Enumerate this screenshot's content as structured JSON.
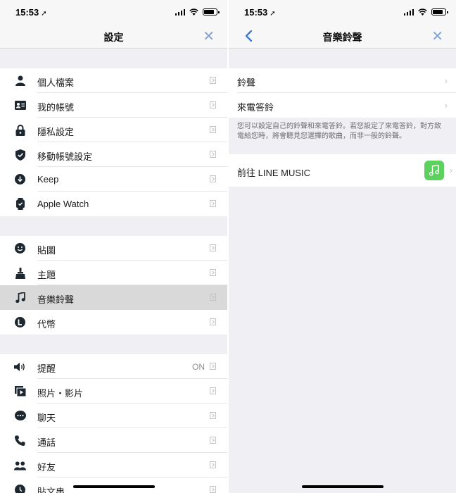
{
  "status_left": {
    "time": "15:53",
    "loc": "➚"
  },
  "status_right": {
    "time": "15:53",
    "loc": "➚"
  },
  "left": {
    "title": "設定",
    "close": "✕",
    "sections": [
      {
        "items": [
          {
            "label": "個人檔案",
            "icon": "person-icon"
          },
          {
            "label": "我的帳號",
            "icon": "id-card-icon"
          },
          {
            "label": "隱私設定",
            "icon": "lock-icon"
          },
          {
            "label": "移動帳號設定",
            "icon": "shield-check-icon"
          },
          {
            "label": "Keep",
            "icon": "keep-icon"
          },
          {
            "label": "Apple Watch",
            "icon": "watch-icon"
          }
        ]
      },
      {
        "items": [
          {
            "label": "貼圖",
            "icon": "smiley-icon"
          },
          {
            "label": "主題",
            "icon": "brush-icon"
          },
          {
            "label": "音樂鈴聲",
            "icon": "music-note-icon",
            "selected": true
          },
          {
            "label": "代幣",
            "icon": "coin-icon"
          }
        ]
      },
      {
        "items": [
          {
            "label": "提醒",
            "icon": "speaker-icon",
            "value": "ON"
          },
          {
            "label": "照片・影片",
            "icon": "photo-video-icon"
          },
          {
            "label": "聊天",
            "icon": "chat-bubble-icon"
          },
          {
            "label": "通話",
            "icon": "phone-icon"
          },
          {
            "label": "好友",
            "icon": "friends-icon"
          },
          {
            "label": "貼文串",
            "icon": "timeline-icon"
          }
        ]
      }
    ]
  },
  "right": {
    "title": "音樂鈴聲",
    "close": "✕",
    "rows": [
      {
        "label": "鈴聲"
      },
      {
        "label": "來電答鈴"
      }
    ],
    "description": "您可以設定自己的鈴聲和來電答鈴。若您設定了來電答鈴，對方致電給您時，將會聽見您選擇的歌曲，而非一般的鈴聲。",
    "line_music": {
      "label": "前往 LINE MUSIC"
    },
    "chevron": "›",
    "accent": "#3b7bd4",
    "line_music_color": "#5cd15e"
  }
}
